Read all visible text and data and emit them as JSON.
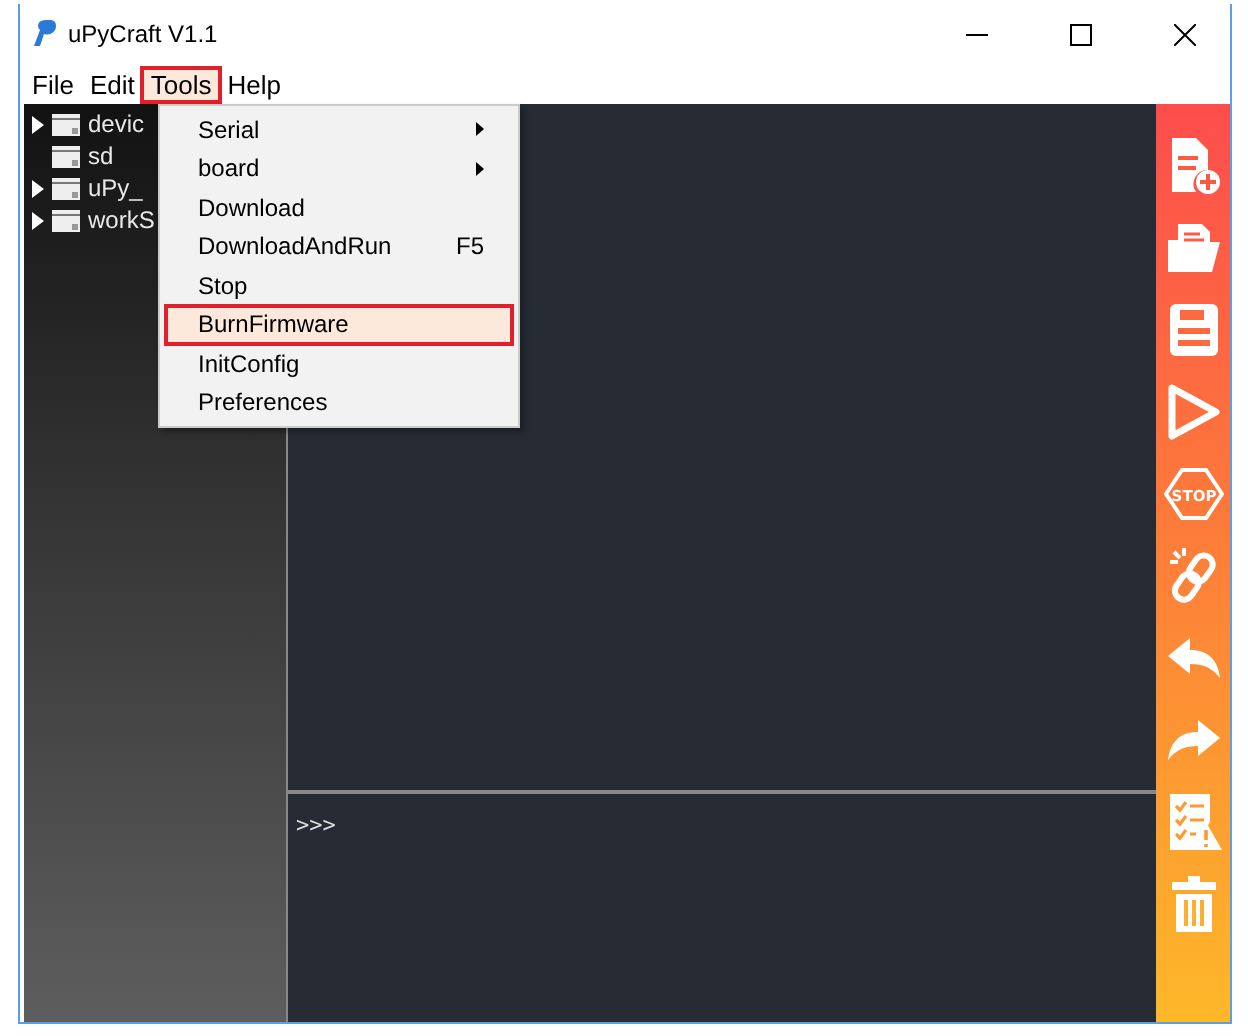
{
  "window": {
    "title": "uPyCraft V1.1"
  },
  "menu_bar": [
    {
      "label": "File",
      "selected": false
    },
    {
      "label": "Edit",
      "selected": false
    },
    {
      "label": "Tools",
      "selected": true
    },
    {
      "label": "Help",
      "selected": false
    }
  ],
  "tree": [
    {
      "label": "devic",
      "expandable": true
    },
    {
      "label": "sd",
      "expandable": false
    },
    {
      "label": "uPy_",
      "expandable": true
    },
    {
      "label": "workS",
      "expandable": true
    }
  ],
  "tools_menu": [
    {
      "label": "Serial",
      "submenu": true,
      "selected": false
    },
    {
      "label": "board",
      "submenu": true,
      "selected": false
    },
    {
      "label": "Download",
      "submenu": false,
      "selected": false
    },
    {
      "label": "DownloadAndRun",
      "shortcut": "F5",
      "submenu": false,
      "selected": false
    },
    {
      "label": "Stop",
      "submenu": false,
      "selected": false
    },
    {
      "label": "BurnFirmware",
      "submenu": false,
      "selected": true
    },
    {
      "label": "InitConfig",
      "submenu": false,
      "selected": false
    },
    {
      "label": "Preferences",
      "submenu": false,
      "selected": false
    }
  ],
  "console": {
    "prompt": ">>>"
  },
  "toolbar": [
    {
      "kind": "new"
    },
    {
      "kind": "open"
    },
    {
      "kind": "save"
    },
    {
      "kind": "run"
    },
    {
      "kind": "stop",
      "label": "STOP"
    },
    {
      "kind": "connect"
    },
    {
      "kind": "undo"
    },
    {
      "kind": "redo"
    },
    {
      "kind": "check"
    },
    {
      "kind": "delete"
    }
  ]
}
